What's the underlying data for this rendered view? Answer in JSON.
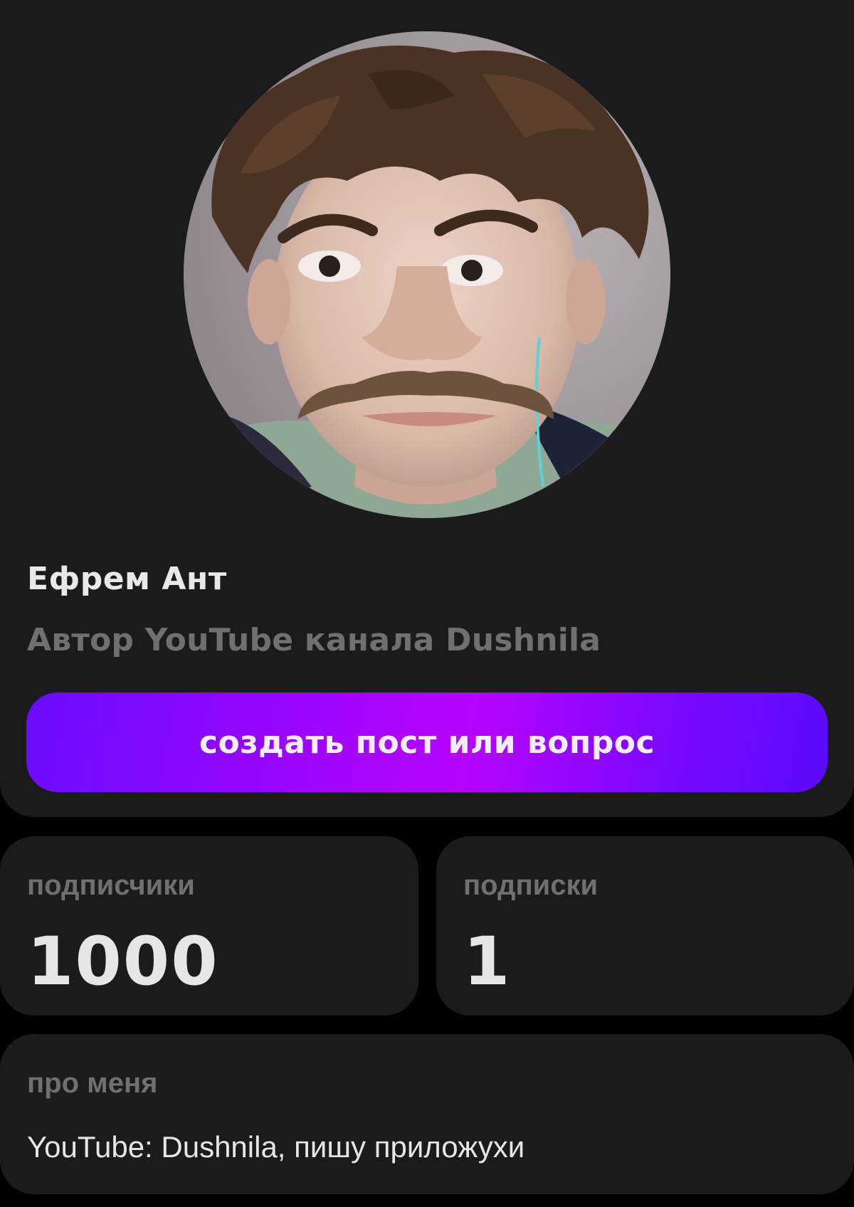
{
  "profile": {
    "name": "Ефрем Ант",
    "bio": "Автор YouTube канала Dushnila",
    "create_button_label": "создать пост или вопрос",
    "accent_color": "#9d05ff"
  },
  "stats": {
    "followers_label": "подписчики",
    "followers_value": "1000",
    "following_label": "подписки",
    "following_value": "1"
  },
  "about": {
    "title": "про меня",
    "text": "YouTube: Dushnila, пишу приложухи"
  }
}
